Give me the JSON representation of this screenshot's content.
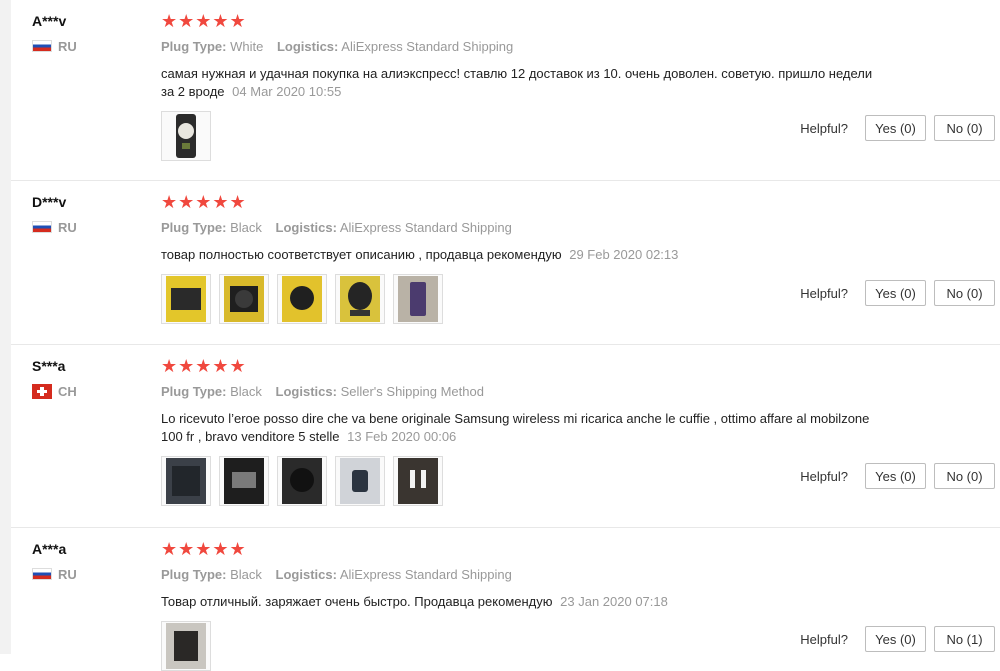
{
  "reviews": [
    {
      "user": "A***v",
      "country": "RU",
      "rating": "★★★★★",
      "plug_label": "Plug Type:",
      "plug_value": "White",
      "logistics_label": "Logistics:",
      "logistics_value": "AliExpress Standard Shipping",
      "text": "самая нужная и удачная покупка на алиэкспресс! ставлю 12 доставок из 10. очень доволен. советую. пришло недели за 2 вроде",
      "date": "04 Mar 2020 10:55",
      "helpful_label": "Helpful?",
      "yes_label": "Yes (0)",
      "no_label": "No (0)"
    },
    {
      "user": "D***v",
      "country": "RU",
      "rating": "★★★★★",
      "plug_label": "Plug Type:",
      "plug_value": "Black",
      "logistics_label": "Logistics:",
      "logistics_value": "AliExpress Standard Shipping",
      "text": "товар полностью соответствует описанию , продавца рекомендую",
      "date": "29 Feb 2020 02:13",
      "helpful_label": "Helpful?",
      "yes_label": "Yes (0)",
      "no_label": "No (0)"
    },
    {
      "user": "S***a",
      "country": "CH",
      "rating": "★★★★★",
      "plug_label": "Plug Type:",
      "plug_value": "Black",
      "logistics_label": "Logistics:",
      "logistics_value": "Seller's Shipping Method",
      "text": "Lo ricevuto l’eroe posso dire che va bene originale Samsung wireless mi ricarica anche le cuffie , ottimo affare al mobilzone 100 fr , bravo venditore 5 stelle",
      "date": "13 Feb 2020 00:06",
      "helpful_label": "Helpful?",
      "yes_label": "Yes (0)",
      "no_label": "No (0)"
    },
    {
      "user": "A***a",
      "country": "RU",
      "rating": "★★★★★",
      "plug_label": "Plug Type:",
      "plug_value": "Black",
      "logistics_label": "Logistics:",
      "logistics_value": "AliExpress Standard Shipping",
      "text": "Товар отличный. заряжает очень быстро. Продавца рекомендую",
      "date": "23 Jan 2020 07:18",
      "helpful_label": "Helpful?",
      "yes_label": "Yes (0)",
      "no_label": "No (1)"
    }
  ],
  "colors": {
    "star": "#f0483e",
    "muted": "#999999",
    "border": "#e8e8e8"
  }
}
